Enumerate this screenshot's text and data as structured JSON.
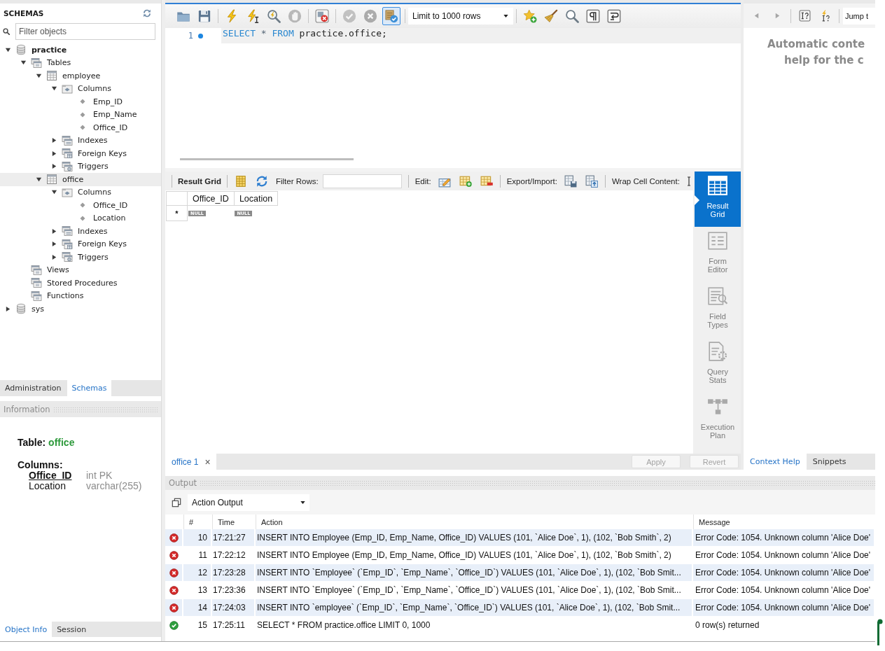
{
  "navigator": {
    "title": "SCHEMAS",
    "filter": {
      "placeholder": "Filter objects"
    },
    "tree": [
      {
        "label": "practice",
        "kind": "schema",
        "default": true,
        "expanded": true,
        "selected": false,
        "children": [
          {
            "label": "Tables",
            "kind": "group",
            "expanded": true,
            "selected": false,
            "children": [
              {
                "label": "employee",
                "kind": "table",
                "expanded": true,
                "selected": false,
                "children": [
                  {
                    "label": "Columns",
                    "kind": "columns",
                    "expanded": true,
                    "selected": false,
                    "children": [
                      {
                        "label": "Emp_ID",
                        "kind": "column",
                        "selected": false
                      },
                      {
                        "label": "Emp_Name",
                        "kind": "column",
                        "selected": false
                      },
                      {
                        "label": "Office_ID",
                        "kind": "column",
                        "selected": false
                      }
                    ]
                  },
                  {
                    "label": "Indexes",
                    "kind": "indexes",
                    "expanded": false,
                    "selected": false
                  },
                  {
                    "label": "Foreign Keys",
                    "kind": "foreign_keys",
                    "expanded": false,
                    "selected": false
                  },
                  {
                    "label": "Triggers",
                    "kind": "triggers",
                    "expanded": false,
                    "selected": false
                  }
                ]
              },
              {
                "label": "office",
                "kind": "table",
                "expanded": true,
                "selected": true,
                "children": [
                  {
                    "label": "Columns",
                    "kind": "columns",
                    "expanded": true,
                    "selected": false,
                    "children": [
                      {
                        "label": "Office_ID",
                        "kind": "column",
                        "selected": false
                      },
                      {
                        "label": "Location",
                        "kind": "column",
                        "selected": false
                      }
                    ]
                  },
                  {
                    "label": "Indexes",
                    "kind": "indexes",
                    "expanded": false,
                    "selected": false
                  },
                  {
                    "label": "Foreign Keys",
                    "kind": "foreign_keys",
                    "expanded": false,
                    "selected": false
                  },
                  {
                    "label": "Triggers",
                    "kind": "triggers",
                    "expanded": false,
                    "selected": false
                  }
                ]
              }
            ]
          },
          {
            "label": "Views",
            "kind": "group",
            "selected": false
          },
          {
            "label": "Stored Procedures",
            "kind": "group",
            "selected": false
          },
          {
            "label": "Functions",
            "kind": "group",
            "selected": false
          }
        ]
      },
      {
        "label": "sys",
        "kind": "schema",
        "default": false,
        "expanded": false,
        "selected": false
      }
    ]
  },
  "navigator_tabs": [
    {
      "label": "Administration",
      "selected": false
    },
    {
      "label": "Schemas",
      "selected": true
    }
  ],
  "information": {
    "title": "Information",
    "object": {
      "label": "Table:",
      "name": "office"
    },
    "columns_title": "Columns:",
    "columns": [
      {
        "name": "Office_ID",
        "type": "int PK",
        "primary_key": true
      },
      {
        "name": "Location",
        "type": "varchar(255)",
        "primary_key": false
      }
    ]
  },
  "info_tabs": [
    {
      "label": "Object Info",
      "selected": true
    },
    {
      "label": "Session",
      "selected": false
    }
  ],
  "editor_toolbar": {
    "groups": [
      {
        "buttons": [
          {
            "kind": "open",
            "disabled": false,
            "on": false
          },
          {
            "kind": "save",
            "disabled": false,
            "on": false
          }
        ]
      },
      {
        "buttons": [
          {
            "kind": "execute",
            "disabled": false,
            "on": false
          },
          {
            "kind": "execute_current",
            "disabled": false,
            "on": false
          },
          {
            "kind": "explain",
            "disabled": false,
            "on": false
          },
          {
            "kind": "stop",
            "disabled": true,
            "on": false
          }
        ]
      },
      {
        "buttons": [
          {
            "kind": "stop_on_error",
            "disabled": false,
            "on": false
          }
        ]
      },
      {
        "buttons": [
          {
            "kind": "commit",
            "disabled": true,
            "on": false
          },
          {
            "kind": "rollback",
            "disabled": true,
            "on": false
          },
          {
            "kind": "autocommit",
            "disabled": false,
            "on": true
          }
        ]
      },
      {
        "buttons": [
          {
            "kind": "row_limit",
            "value": "Limit to 1000 rows",
            "disabled": false,
            "on": false
          }
        ]
      },
      {
        "buttons": [
          {
            "kind": "add_snippet",
            "disabled": false,
            "on": false
          },
          {
            "kind": "beautify",
            "disabled": false,
            "on": false
          },
          {
            "kind": "find",
            "disabled": false,
            "on": false
          },
          {
            "kind": "invisibles",
            "disabled": false,
            "on": false
          },
          {
            "kind": "wrap",
            "disabled": false,
            "on": false
          }
        ]
      }
    ]
  },
  "editor": {
    "lines": [
      {
        "number": "1",
        "marker": true,
        "current": true,
        "tokens": [
          {
            "kind": "keyword",
            "text": "SELECT"
          },
          {
            "kind": "operator",
            "text": " * "
          },
          {
            "kind": "keyword",
            "text": "FROM"
          },
          {
            "kind": "identifier",
            "text": " practice.office;"
          }
        ]
      }
    ]
  },
  "result": {
    "toolbar": {
      "title": "Result Grid",
      "view_buttons": [
        {
          "kind": "grid_toggle"
        },
        {
          "kind": "refresh"
        }
      ],
      "filter": {
        "label": "Filter Rows:"
      },
      "edit": {
        "label": "Edit:",
        "buttons": [
          {
            "kind": "edit_row"
          },
          {
            "kind": "add_row"
          },
          {
            "kind": "delete_row"
          }
        ]
      },
      "export": {
        "label": "Export/Import:",
        "buttons": [
          {
            "kind": "export"
          },
          {
            "kind": "import"
          }
        ]
      },
      "wrap": {
        "label": "Wrap Cell Content:",
        "buttons": [
          {
            "kind": "wrap_toggle"
          }
        ]
      }
    },
    "grid": {
      "columns": [
        "Office_ID",
        "Location"
      ],
      "new_row": {
        "marker": "*",
        "cells": [
          "NULL",
          "NULL"
        ]
      }
    },
    "views": [
      {
        "label": "Result Grid",
        "kind": "grid",
        "selected": true
      },
      {
        "label": "Form Editor",
        "kind": "form",
        "selected": false
      },
      {
        "label": "Field Types",
        "kind": "fields",
        "selected": false
      },
      {
        "label": "Query Stats",
        "kind": "stats",
        "selected": false
      },
      {
        "label": "Execution Plan",
        "kind": "plan",
        "selected": false
      }
    ],
    "tabs": [
      {
        "label": "office 1",
        "selected": true,
        "close": "×"
      }
    ],
    "buttons": [
      {
        "label": "Apply",
        "disabled": true
      },
      {
        "label": "Revert",
        "disabled": true
      }
    ]
  },
  "help_panel": {
    "toolbar": {
      "buttons": [
        {
          "kind": "back",
          "disabled": true
        },
        {
          "kind": "forward",
          "disabled": true
        },
        {
          "kind": "toggle_auto",
          "disabled": false
        },
        {
          "kind": "manual",
          "disabled": false
        }
      ],
      "jump_to": {
        "value": "Jump t"
      }
    },
    "lines": [
      "Automatic conte",
      "help for the c"
    ],
    "tabs": [
      {
        "label": "Context Help",
        "selected": true
      },
      {
        "label": "Snippets",
        "selected": false
      }
    ]
  },
  "output": {
    "title": "Output",
    "view": {
      "value": "Action Output"
    },
    "columns": [
      "#",
      "Time",
      "Action",
      "Message"
    ],
    "rows": [
      {
        "kind": "error",
        "number": "10",
        "time": "17:21:27",
        "action": "INSERT INTO Employee (Emp_ID, Emp_Name, Office_ID) VALUES (101, `Alice Doe`, 1), (102, `Bob Smith`, 2)",
        "message": "Error Code: 1054. Unknown column 'Alice Doe'"
      },
      {
        "kind": "error",
        "number": "11",
        "time": "17:22:12",
        "action": "INSERT INTO Employee (Emp_ID, Emp_Name, Office_ID) VALUES (101, `Alice Doe`, 1), (102, `Bob Smith`, 2)",
        "message": "Error Code: 1054. Unknown column 'Alice Doe'"
      },
      {
        "kind": "error",
        "number": "12",
        "time": "17:23:28",
        "action": "INSERT INTO `Employee` (`Emp_ID`, `Emp_Name`, `Office_ID`) VALUES (101, `Alice Doe`, 1), (102, `Bob Smit...",
        "message": "Error Code: 1054. Unknown column 'Alice Doe'"
      },
      {
        "kind": "error",
        "number": "13",
        "time": "17:23:36",
        "action": "INSERT INTO `Employee` (`Emp_ID`, `Emp_Name`, `Office_ID`) VALUES (101, `Alice Doe`, 1), (102, `Bob Smit...",
        "message": "Error Code: 1054. Unknown column 'Alice Doe'"
      },
      {
        "kind": "error",
        "number": "14",
        "time": "17:24:03",
        "action": "INSERT INTO `employee` (`Emp_ID`, `Emp_Name`, `Office_ID`) VALUES (101, `Alice Doe`, 1), (102, `Bob Smit...",
        "message": "Error Code: 1054. Unknown column 'Alice Doe'"
      },
      {
        "kind": "ok",
        "number": "15",
        "time": "17:25:11",
        "action": "SELECT * FROM practice.office LIMIT 0, 1000",
        "message": "0 row(s) returned"
      }
    ]
  }
}
